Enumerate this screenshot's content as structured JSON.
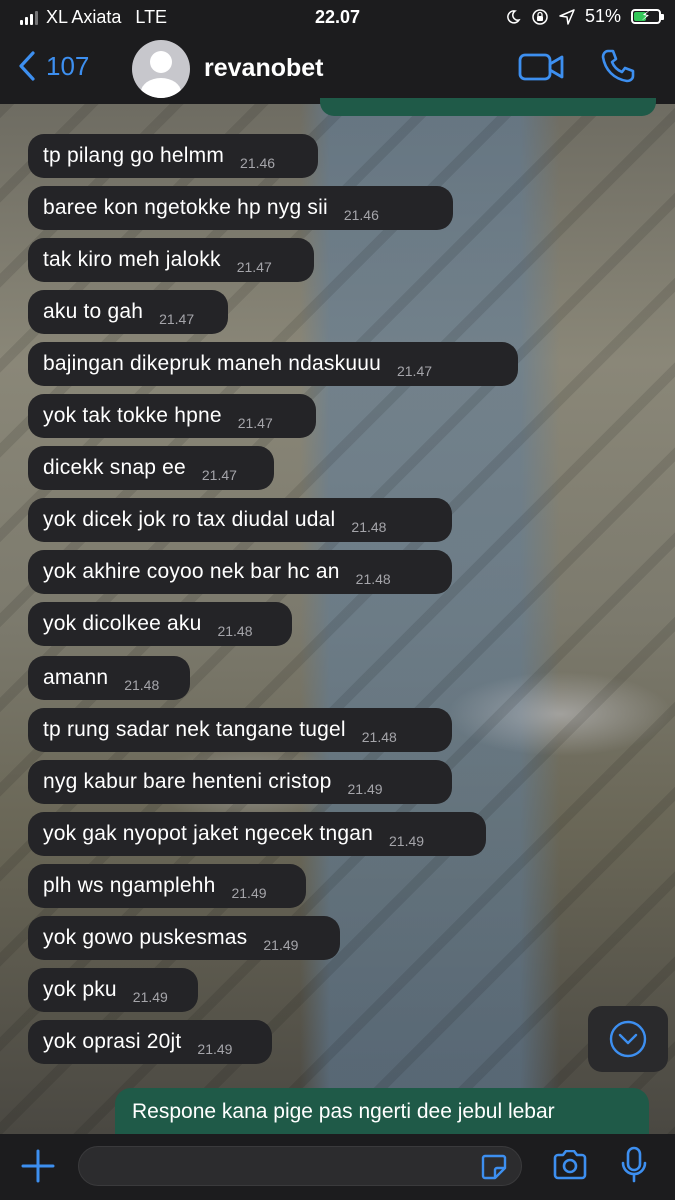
{
  "status_bar": {
    "carrier": "XL Axiata",
    "network": "LTE",
    "time": "22.07",
    "battery": "51%",
    "battery_level": 0.51
  },
  "header": {
    "back_count": "107",
    "contact_name": "revanobet"
  },
  "messages": [
    {
      "text": "tp pilang go helmm",
      "time": "21.46"
    },
    {
      "text": "baree kon ngetokke hp nyg sii",
      "time": "21.46"
    },
    {
      "text": "tak kiro meh jalokk",
      "time": "21.47"
    },
    {
      "text": "aku to gah",
      "time": "21.47"
    },
    {
      "text": "bajingan dikepruk maneh ndaskuuu",
      "time": "21.47"
    },
    {
      "text": "yok tak tokke hpne",
      "time": "21.47"
    },
    {
      "text": "dicekk snap ee",
      "time": "21.47"
    },
    {
      "text": "yok dicek jok ro tax diudal udal",
      "time": "21.48"
    },
    {
      "text": "yok akhire coyoo nek bar hc an",
      "time": "21.48"
    },
    {
      "text": "yok dicolkee aku",
      "time": "21.48"
    },
    {
      "text": "amann",
      "time": "21.48"
    },
    {
      "text": "tp rung sadar nek tangane tugel",
      "time": "21.48"
    },
    {
      "text": "nyg kabur bare henteni cristop",
      "time": "21.49"
    },
    {
      "text": "yok gak nyopot jaket ngecek tngan",
      "time": "21.49"
    },
    {
      "text": "plh ws ngamplehh",
      "time": "21.49"
    },
    {
      "text": "yok gowo puskesmas",
      "time": "21.49"
    },
    {
      "text": "yok pku",
      "time": "21.49"
    },
    {
      "text": "yok oprasi 20jt",
      "time": "21.49"
    }
  ],
  "outgoing_message": "Respone kana pige pas ngerti dee jebul lebar",
  "icons": {
    "back": "chevron-left-icon",
    "avatar": "person-icon",
    "video": "video-camera-icon",
    "call": "phone-icon",
    "scroll_down": "chevron-down-circle-icon",
    "attach": "plus-icon",
    "sticker": "sticker-icon",
    "camera": "camera-icon",
    "mic": "microphone-icon"
  },
  "colors": {
    "accent": "#3d8ff0",
    "incoming_bubble": "#242427",
    "outgoing_bubble": "#1f5a48",
    "battery": "#34c759"
  }
}
